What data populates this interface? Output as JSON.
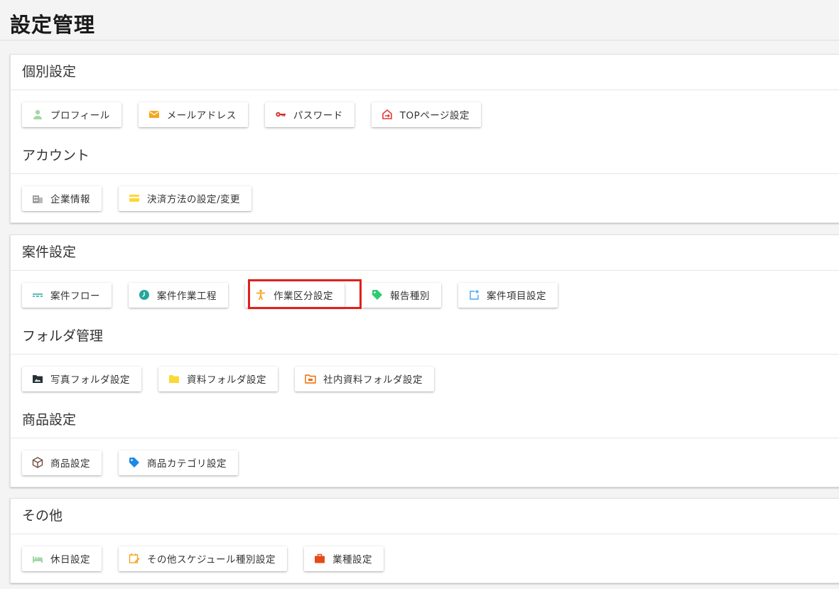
{
  "page": {
    "title": "設定管理"
  },
  "cards": [
    {
      "sections": [
        {
          "title": "個別設定",
          "buttons": [
            {
              "label": "プロフィール",
              "icon": "person-icon",
              "color": "#a5d6a7"
            },
            {
              "label": "メールアドレス",
              "icon": "mail-icon",
              "color": "#f5a623"
            },
            {
              "label": "パスワード",
              "icon": "key-icon",
              "color": "#d32f2f"
            },
            {
              "label": "TOPページ設定",
              "icon": "home-arrow-icon",
              "color": "#e53935"
            }
          ]
        },
        {
          "title": "アカウント",
          "buttons": [
            {
              "label": "企業情報",
              "icon": "building-icon",
              "color": "#9e9e9e"
            },
            {
              "label": "決済方法の設定/変更",
              "icon": "credit-card-icon",
              "color": "#fdd835"
            }
          ]
        }
      ]
    },
    {
      "sections": [
        {
          "title": "案件設定",
          "buttons": [
            {
              "label": "案件フロー",
              "icon": "flow-icon",
              "color": "#26a69a"
            },
            {
              "label": "案件作業工程",
              "icon": "clock-icon",
              "color": "#26a69a"
            },
            {
              "label": "作業区分設定",
              "icon": "accessibility-icon",
              "color": "#f5a623"
            },
            {
              "label": "報告種別",
              "icon": "tag-icon",
              "color": "#2ecc71"
            },
            {
              "label": "案件項目設定",
              "icon": "add-box-icon",
              "color": "#42a5f5"
            }
          ]
        },
        {
          "title": "フォルダ管理",
          "buttons": [
            {
              "label": "写真フォルダ設定",
              "icon": "photo-folder-icon",
              "color": "#263238"
            },
            {
              "label": "資料フォルダ設定",
              "icon": "folder-icon",
              "color": "#fdd835"
            },
            {
              "label": "社内資料フォルダ設定",
              "icon": "shared-folder-icon",
              "color": "#ef6c00"
            }
          ]
        },
        {
          "title": "商品設定",
          "buttons": [
            {
              "label": "商品設定",
              "icon": "box-icon",
              "color": "#6d4c41"
            },
            {
              "label": "商品カテゴリ設定",
              "icon": "label-icon",
              "color": "#1e88e5"
            }
          ]
        }
      ]
    },
    {
      "sections": [
        {
          "title": "その他",
          "buttons": [
            {
              "label": "休日設定",
              "icon": "bed-icon",
              "color": "#a5d6a7"
            },
            {
              "label": "その他スケジュール種別設定",
              "icon": "calendar-edit-icon",
              "color": "#f5a623"
            },
            {
              "label": "業種設定",
              "icon": "briefcase-icon",
              "color": "#e64a19"
            }
          ]
        }
      ]
    }
  ]
}
